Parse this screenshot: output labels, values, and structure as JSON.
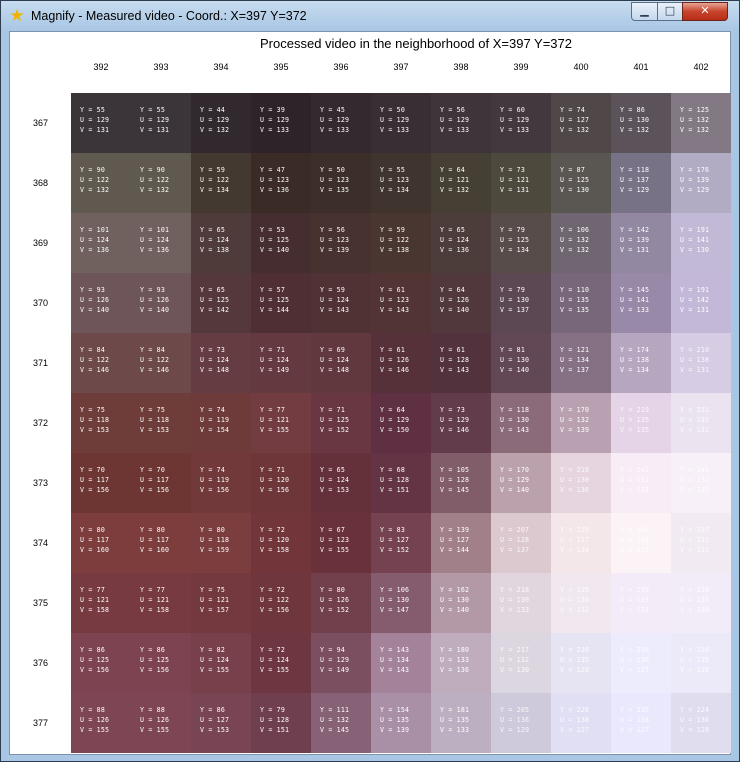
{
  "window": {
    "title": "Magnify - Measured video - Coord.: X=397 Y=372",
    "icon": "star-icon",
    "controls": {
      "minimize": "▁",
      "maximize": "□",
      "close": "✕"
    }
  },
  "heading": "Processed video in the neighborhood of X=397  Y=372",
  "columns": [
    "392",
    "393",
    "394",
    "395",
    "396",
    "397",
    "398",
    "399",
    "400",
    "401",
    "402"
  ],
  "rows": [
    "367",
    "368",
    "369",
    "370",
    "371",
    "372",
    "373",
    "374",
    "375",
    "376",
    "377"
  ],
  "cells": [
    [
      [
        55,
        129,
        131
      ],
      [
        55,
        129,
        131
      ],
      [
        44,
        129,
        132
      ],
      [
        39,
        129,
        133
      ],
      [
        45,
        129,
        133
      ],
      [
        50,
        129,
        133
      ],
      [
        56,
        129,
        133
      ],
      [
        60,
        129,
        133
      ],
      [
        74,
        127,
        132
      ],
      [
        86,
        130,
        132
      ],
      [
        125,
        132,
        132
      ]
    ],
    [
      [
        90,
        122,
        132
      ],
      [
        90,
        122,
        132
      ],
      [
        59,
        122,
        134
      ],
      [
        47,
        123,
        136
      ],
      [
        50,
        123,
        135
      ],
      [
        55,
        123,
        134
      ],
      [
        64,
        121,
        132
      ],
      [
        73,
        121,
        131
      ],
      [
        87,
        125,
        130
      ],
      [
        118,
        137,
        129
      ],
      [
        176,
        139,
        129
      ]
    ],
    [
      [
        101,
        124,
        136
      ],
      [
        101,
        124,
        136
      ],
      [
        65,
        124,
        138
      ],
      [
        53,
        125,
        140
      ],
      [
        56,
        123,
        139
      ],
      [
        59,
        122,
        138
      ],
      [
        65,
        124,
        136
      ],
      [
        79,
        125,
        134
      ],
      [
        106,
        132,
        132
      ],
      [
        142,
        139,
        131
      ],
      [
        191,
        141,
        130
      ]
    ],
    [
      [
        93,
        126,
        140
      ],
      [
        93,
        126,
        140
      ],
      [
        65,
        125,
        142
      ],
      [
        57,
        125,
        144
      ],
      [
        59,
        124,
        143
      ],
      [
        61,
        123,
        143
      ],
      [
        64,
        126,
        140
      ],
      [
        79,
        130,
        137
      ],
      [
        110,
        135,
        135
      ],
      [
        145,
        141,
        133
      ],
      [
        191,
        142,
        131
      ]
    ],
    [
      [
        84,
        122,
        146
      ],
      [
        84,
        122,
        146
      ],
      [
        73,
        124,
        148
      ],
      [
        71,
        124,
        149
      ],
      [
        69,
        124,
        148
      ],
      [
        61,
        126,
        146
      ],
      [
        61,
        128,
        143
      ],
      [
        81,
        130,
        140
      ],
      [
        121,
        134,
        137
      ],
      [
        174,
        138,
        134
      ],
      [
        210,
        138,
        131
      ]
    ],
    [
      [
        75,
        118,
        153
      ],
      [
        75,
        118,
        153
      ],
      [
        74,
        119,
        154
      ],
      [
        77,
        121,
        155
      ],
      [
        71,
        125,
        152
      ],
      [
        64,
        129,
        150
      ],
      [
        73,
        129,
        146
      ],
      [
        118,
        130,
        143
      ],
      [
        170,
        132,
        139
      ],
      [
        219,
        135,
        135
      ],
      [
        231,
        133,
        131
      ]
    ],
    [
      [
        70,
        117,
        156
      ],
      [
        70,
        117,
        156
      ],
      [
        74,
        119,
        156
      ],
      [
        71,
        120,
        156
      ],
      [
        65,
        124,
        153
      ],
      [
        68,
        128,
        151
      ],
      [
        105,
        128,
        145
      ],
      [
        170,
        129,
        140
      ],
      [
        219,
        130,
        136
      ],
      [
        241,
        131,
        133
      ],
      [
        243,
        131,
        131
      ]
    ],
    [
      [
        80,
        117,
        160
      ],
      [
        80,
        117,
        160
      ],
      [
        80,
        118,
        159
      ],
      [
        72,
        120,
        158
      ],
      [
        67,
        123,
        155
      ],
      [
        83,
        127,
        152
      ],
      [
        139,
        127,
        144
      ],
      [
        207,
        128,
        137
      ],
      [
        235,
        127,
        134
      ],
      [
        246,
        128,
        132
      ],
      [
        237,
        131,
        131
      ]
    ],
    [
      [
        77,
        121,
        158
      ],
      [
        77,
        121,
        158
      ],
      [
        75,
        121,
        157
      ],
      [
        72,
        122,
        156
      ],
      [
        80,
        126,
        152
      ],
      [
        106,
        130,
        147
      ],
      [
        162,
        130,
        140
      ],
      [
        218,
        130,
        133
      ],
      [
        235,
        130,
        132
      ],
      [
        239,
        133,
        131
      ],
      [
        239,
        133,
        130
      ]
    ],
    [
      [
        86,
        125,
        156
      ],
      [
        86,
        125,
        156
      ],
      [
        82,
        124,
        155
      ],
      [
        72,
        124,
        155
      ],
      [
        94,
        129,
        149
      ],
      [
        143,
        134,
        143
      ],
      [
        180,
        133,
        136
      ],
      [
        217,
        132,
        130
      ],
      [
        230,
        135,
        128
      ],
      [
        238,
        136,
        127
      ],
      [
        236,
        135,
        128
      ]
    ],
    [
      [
        88,
        126,
        155
      ],
      [
        88,
        126,
        155
      ],
      [
        86,
        127,
        153
      ],
      [
        79,
        128,
        151
      ],
      [
        111,
        132,
        145
      ],
      [
        154,
        135,
        139
      ],
      [
        181,
        135,
        133
      ],
      [
        205,
        136,
        129
      ],
      [
        226,
        138,
        127
      ],
      [
        235,
        138,
        127
      ],
      [
        224,
        136,
        128
      ]
    ]
  ]
}
